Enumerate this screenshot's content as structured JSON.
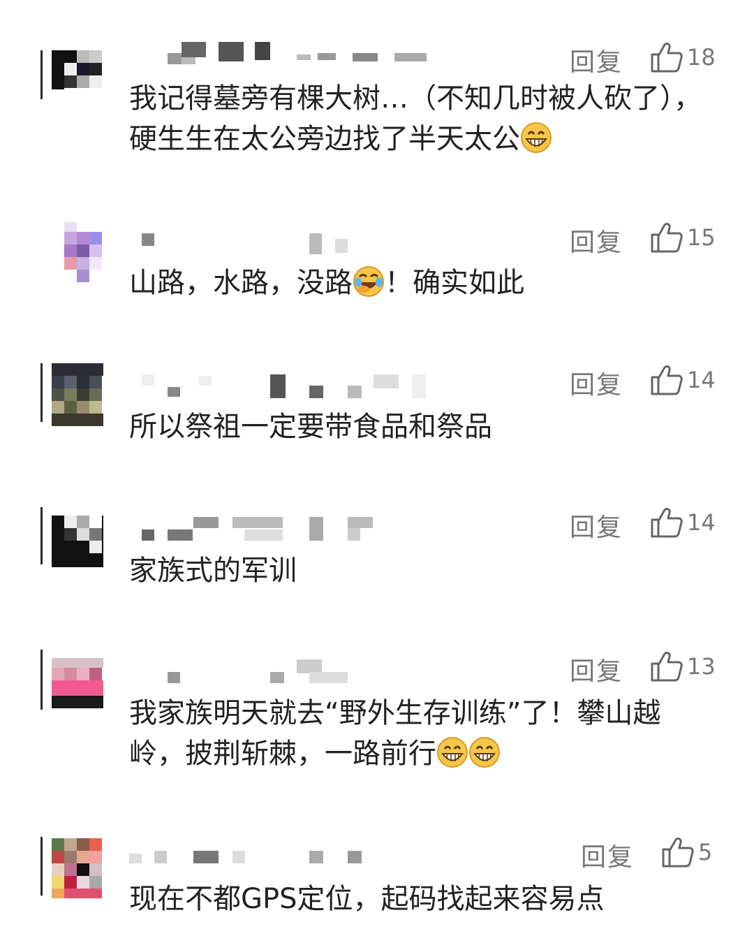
{
  "reply_label": "回复",
  "comments": [
    {
      "likes": "18",
      "text": "我记得墓旁有棵大树…（不知几时被人砍了），硬生生在太公旁边找了半天太公",
      "emoji": [
        "grin-icon"
      ]
    },
    {
      "likes": "15",
      "text_a": "山路，水路，没路",
      "emoji": [
        "laugh-cry-icon"
      ],
      "text_b": "！确实如此"
    },
    {
      "likes": "14",
      "text": "所以祭祖一定要带食品和祭品"
    },
    {
      "likes": "14",
      "text": "家族式的军训"
    },
    {
      "likes": "13",
      "text": "我家族明天就去“野外生存训练”了！攀山越岭，披荆斩棘，一路前行",
      "emoji": [
        "grin-icon",
        "grin-icon"
      ]
    },
    {
      "likes": "5",
      "text": "现在不都GPS定位，起码找起来容易点"
    }
  ],
  "colors": {
    "text": "#222222",
    "meta": "#777777",
    "emoji_face": "#F7C64A"
  }
}
